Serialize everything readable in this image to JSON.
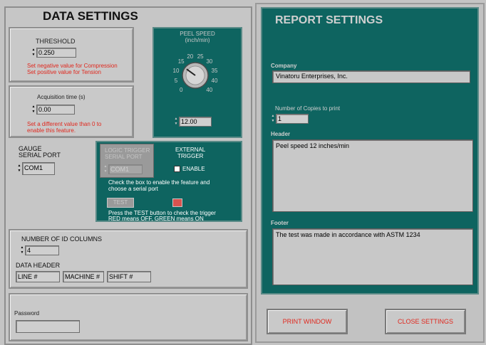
{
  "data_settings": {
    "title": "DATA SETTINGS",
    "threshold": {
      "label": "THRESHOLD",
      "value": "0.250",
      "note1": "Set negative value for Compression",
      "note2": "Set positive value for Tension"
    },
    "acquisition": {
      "label": "Acquisition time (s)",
      "value": "0.00",
      "note1": "Set a different value than 0 to",
      "note2": "enable this feature."
    },
    "peel_speed": {
      "label1": "PEEL SPEED",
      "label2": "(inch/min)",
      "dial_ticks": [
        "0",
        "5",
        "10",
        "15",
        "20",
        "25",
        "30",
        "35",
        "40",
        "40"
      ],
      "dial_value": 12,
      "value": "12.00"
    },
    "gauge": {
      "label1": "GAUGE",
      "label2": "SERIAL PORT",
      "value": "COM1"
    },
    "trigger": {
      "logic_label1": "LOGIC TRIGGER",
      "logic_label2": "SERIAL PORT",
      "logic_value": "COM1",
      "external_label1": "EXTERNAL",
      "external_label2": "TRIGGER",
      "enable_label": "ENABLE",
      "enabled": false,
      "help1": "Check the box to enable the feature and",
      "help2": "choose a serial port",
      "test_label": "TEST",
      "help3": "Press the TEST button to check the trigger",
      "help4": "RED means OFF, GREEN means ON",
      "led_color": "#d9534f"
    },
    "id_columns": {
      "label": "NUMBER OF ID COLUMNS",
      "value": "4",
      "header_label": "DATA HEADER",
      "headers": [
        "LINE #",
        "MACHINE #",
        "SHIFT #"
      ]
    },
    "password": {
      "label": "Password",
      "value": ""
    }
  },
  "report_settings": {
    "title": "REPORT SETTINGS",
    "company_label": "Company",
    "company_value": "Vinatoru Enterprises, Inc.",
    "copies_label": "Number of Copies to print",
    "copies_value": "1",
    "header_label": "Header",
    "header_value": "Peel speed 12 inches/min",
    "footer_label": "Footer",
    "footer_value": "The test was made in accordance with ASTM 1234"
  },
  "buttons": {
    "print": "PRINT WINDOW",
    "close": "CLOSE SETTINGS"
  },
  "colors": {
    "teal": "#0e6460",
    "panel_grey": "#c9c9c9",
    "warning_red": "#e0281e"
  }
}
